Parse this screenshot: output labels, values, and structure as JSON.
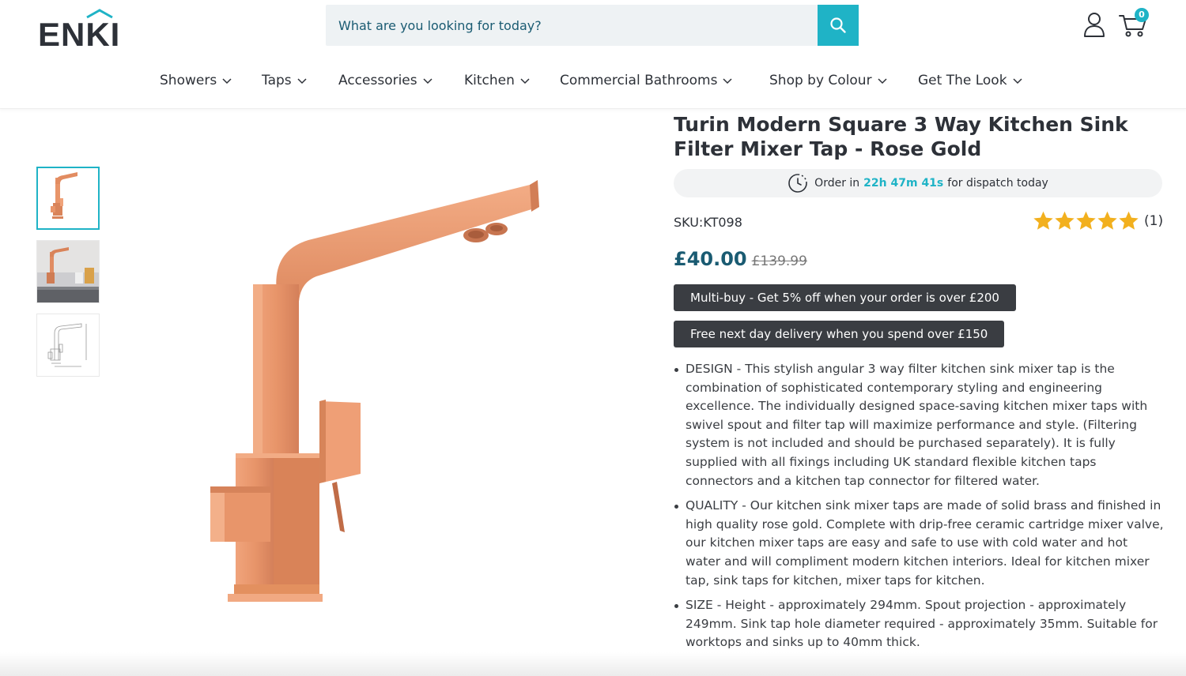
{
  "brand": {
    "logo_text": "ENKI"
  },
  "search": {
    "placeholder": "What are you looking for today?",
    "icon": "search-icon"
  },
  "header": {
    "account_icon": "user-icon",
    "cart_icon": "cart-icon",
    "cart_count": "0"
  },
  "nav": {
    "items": [
      {
        "label": "Showers"
      },
      {
        "label": "Taps"
      },
      {
        "label": "Accessories"
      },
      {
        "label": "Kitchen"
      },
      {
        "label": "Commercial Bathrooms"
      },
      {
        "label": "Shop by Colour"
      },
      {
        "label": "Get The Look"
      }
    ]
  },
  "gallery": {
    "thumbnails": [
      {
        "name": "product-front",
        "active": true
      },
      {
        "name": "product-lifestyle",
        "active": false
      },
      {
        "name": "product-technical-drawing",
        "active": false
      }
    ]
  },
  "product": {
    "title": "Turin Modern Square 3 Way Kitchen Sink Filter Mixer Tap - Rose Gold",
    "dispatch": {
      "prefix": "Order in",
      "timer": "22h 47m 41s",
      "suffix": "for dispatch today"
    },
    "sku": "SKU:KT098",
    "rating": {
      "stars": 5,
      "max": 5,
      "count": "(1)"
    },
    "price": "£40.00",
    "was_price": "£139.99",
    "promos": [
      "Multi-buy - Get 5% off when your order is over £200",
      "Free next day delivery when you spend over £150"
    ],
    "description": [
      "DESIGN - This stylish angular 3 way filter kitchen sink mixer tap is the combination of sophisticated contemporary styling and engineering excellence. The individually designed space-saving kitchen mixer taps with swivel spout and filter tap will maximize performance and style. (Filtering system is not included and should be purchased separately). It is fully supplied with all fixings including UK standard flexible kitchen taps connectors and a kitchen tap connector for filtered water.",
      "QUALITY - Our kitchen sink mixer taps are made of solid brass and finished in high quality rose gold. Complete with drip-free ceramic cartridge mixer valve, our kitchen mixer taps are easy and safe to use with cold water and hot water and will compliment modern kitchen interiors. Ideal for kitchen mixer tap, sink taps for kitchen, mixer taps for kitchen.",
      "SIZE - Height - approximately 294mm. Spout projection - approximately 249mm. Sink tap hole diameter required - approximately 35mm. Suitable for worktops and sinks up to 40mm thick."
    ]
  },
  "colors": {
    "accent": "#1fb3c6",
    "price": "#1a5b72",
    "promo_bg": "#3a3d42",
    "rose_gold": "#e8956a",
    "star": "#f2b01e"
  }
}
